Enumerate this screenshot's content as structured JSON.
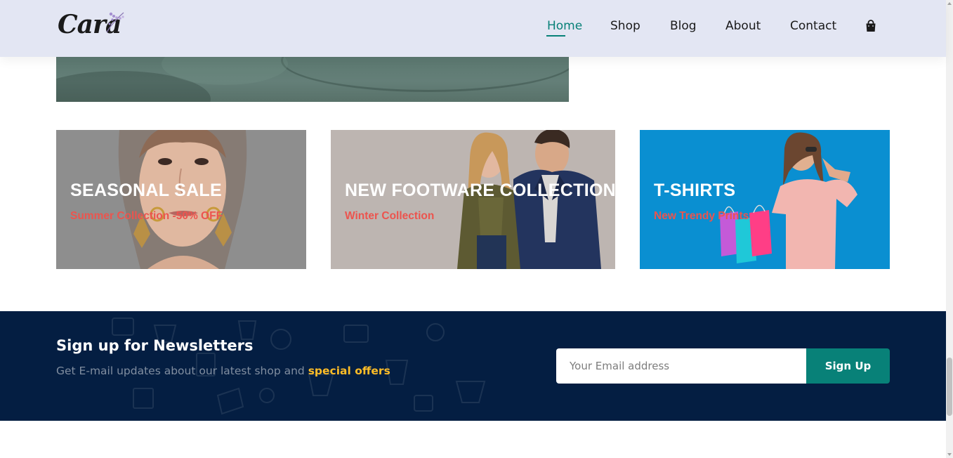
{
  "brand": {
    "logo_text": "Cara"
  },
  "nav": {
    "items": [
      {
        "label": "Home",
        "active": true
      },
      {
        "label": "Shop",
        "active": false
      },
      {
        "label": "Blog",
        "active": false
      },
      {
        "label": "About",
        "active": false
      },
      {
        "label": "Contact",
        "active": false
      }
    ],
    "cart_icon": "shopping-bag-icon",
    "active_color": "#088178"
  },
  "banners": [
    {
      "title": "SEASONAL SALE",
      "subtitle": "Summer Collection -50% OFF",
      "background": "#8e8e8e"
    },
    {
      "title": "NEW FOOTWARE COLLECTION",
      "subtitle": "Winter Collection",
      "background": "#bdb5b1"
    },
    {
      "title": "T-SHIRTS",
      "subtitle": "New Trendy Prints",
      "background": "#0a8fd1"
    }
  ],
  "newsletter": {
    "title": "Sign up for Newsletters",
    "text": "Get E-mail updates about our latest shop and",
    "highlight": "special offers",
    "email_placeholder": "Your Email address",
    "button_label": "Sign Up",
    "background": "#041e42",
    "button_color": "#088178",
    "highlight_color": "#ffbd27"
  },
  "colors": {
    "header_bg": "#e3e6f3",
    "banner_subtitle": "#ec544e"
  }
}
